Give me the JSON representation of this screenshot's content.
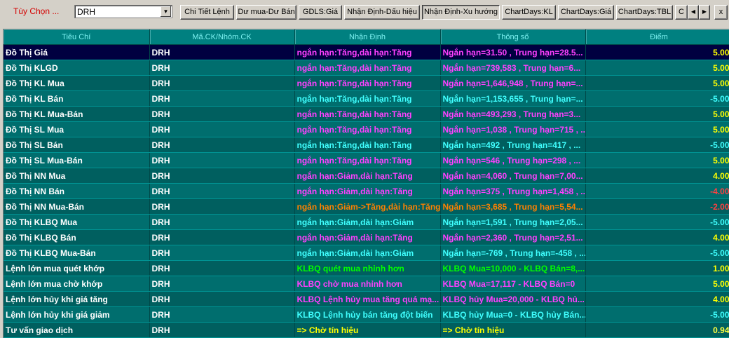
{
  "toolbar": {
    "label": "Tùy Chọn ...",
    "symbol_value": "DRH",
    "buttons": [
      "Chi Tiết Lệnh",
      "Dư mua-Dư Bán",
      "GDLS:Giá",
      "Nhận Định-Dấu hiệu",
      "Nhận Định-Xu hướng",
      "ChartDays:KL",
      "ChartDays:Giá",
      "ChartDays:TBL",
      "C"
    ],
    "pressed_button": "Nhận Định-Xu hướng",
    "prev_label": "◀",
    "next_label": "▶",
    "close_label": "x"
  },
  "table": {
    "headers": [
      "Tiêu Chí",
      "Mã.CK/Nhóm.CK",
      "Nhận Định",
      "Thông số",
      "Điểm"
    ],
    "colors": {
      "magenta": "#ff40ff",
      "cyan": "#40ffff",
      "orange": "#ff8000",
      "green": "#00ff00",
      "yellow": "#ffff00",
      "pos_score": "#ffff00",
      "neg_score": "#40ffff",
      "red_score": "#ff4040",
      "low_score": "#ffff40"
    },
    "rows": [
      {
        "name": "Đồ Thị Giá",
        "code": "DRH",
        "assessment": "ngắn hạn:Tăng,dài hạn:Tăng",
        "params": "Ngắn hạn=31.50 , Trung hạn=28.5...",
        "score": "5.00",
        "color": "magenta",
        "score_color": "pos_score"
      },
      {
        "name": "Đồ Thị KLGD",
        "code": "DRH",
        "assessment": "ngắn hạn:Tăng,dài hạn:Tăng",
        "params": "Ngắn hạn=739,583 , Trung hạn=6...",
        "score": "5.00",
        "color": "magenta",
        "score_color": "pos_score"
      },
      {
        "name": "Đồ Thị KL Mua",
        "code": "DRH",
        "assessment": "ngắn hạn:Tăng,dài hạn:Tăng",
        "params": "Ngắn hạn=1,646,948 , Trung hạn=...",
        "score": "5.00",
        "color": "magenta",
        "score_color": "pos_score"
      },
      {
        "name": "Đồ Thị KL Bán",
        "code": "DRH",
        "assessment": "ngắn hạn:Tăng,dài hạn:Tăng",
        "params": "Ngắn hạn=1,153,655 , Trung hạn=...",
        "score": "-5.00",
        "color": "cyan",
        "score_color": "neg_score"
      },
      {
        "name": "Đồ Thị KL Mua-Bán",
        "code": "DRH",
        "assessment": "ngắn hạn:Tăng,dài hạn:Tăng",
        "params": "Ngắn hạn=493,293 , Trung hạn=3...",
        "score": "5.00",
        "color": "magenta",
        "score_color": "pos_score"
      },
      {
        "name": "Đồ Thị SL Mua",
        "code": "DRH",
        "assessment": "ngắn hạn:Tăng,dài hạn:Tăng",
        "params": "Ngắn hạn=1,038 , Trung hạn=715 , ...",
        "score": "5.00",
        "color": "magenta",
        "score_color": "pos_score"
      },
      {
        "name": "Đồ Thị SL Bán",
        "code": "DRH",
        "assessment": "ngắn hạn:Tăng,dài hạn:Tăng",
        "params": "Ngắn hạn=492 , Trung hạn=417 , ...",
        "score": "-5.00",
        "color": "cyan",
        "score_color": "neg_score"
      },
      {
        "name": "Đồ Thị SL Mua-Bán",
        "code": "DRH",
        "assessment": "ngắn hạn:Tăng,dài hạn:Tăng",
        "params": "Ngắn hạn=546 , Trung hạn=298 , ...",
        "score": "5.00",
        "color": "magenta",
        "score_color": "pos_score"
      },
      {
        "name": "Đồ Thị NN Mua",
        "code": "DRH",
        "assessment": "ngắn hạn:Giảm,dài hạn:Tăng",
        "params": "Ngắn hạn=4,060 , Trung hạn=7,00...",
        "score": "4.00",
        "color": "magenta",
        "score_color": "pos_score"
      },
      {
        "name": "Đồ Thị NN Bán",
        "code": "DRH",
        "assessment": "ngắn hạn:Giảm,dài hạn:Tăng",
        "params": "Ngắn hạn=375 , Trung hạn=1,458 , ...",
        "score": "-4.00",
        "color": "magenta",
        "score_color": "red_score"
      },
      {
        "name": "Đồ Thị NN Mua-Bán",
        "code": "DRH",
        "assessment": "ngắn hạn:Giảm->Tăng,dài hạn:Tăng",
        "params": "Ngắn hạn=3,685 , Trung hạn=5,54...",
        "score": "-2.00",
        "color": "orange",
        "score_color": "red_score"
      },
      {
        "name": "Đồ Thị KLBQ Mua",
        "code": "DRH",
        "assessment": "ngắn hạn:Giảm,dài hạn:Giảm",
        "params": "Ngắn hạn=1,591 , Trung hạn=2,05...",
        "score": "-5.00",
        "color": "cyan",
        "score_color": "neg_score"
      },
      {
        "name": "Đồ Thị KLBQ Bán",
        "code": "DRH",
        "assessment": "ngắn hạn:Giảm,dài hạn:Tăng",
        "params": "Ngắn hạn=2,360 , Trung hạn=2,51...",
        "score": "4.00",
        "color": "magenta",
        "score_color": "pos_score"
      },
      {
        "name": "Đồ Thị KLBQ Mua-Bán",
        "code": "DRH",
        "assessment": "ngắn hạn:Giảm,dài hạn:Giảm",
        "params": "Ngắn hạn=-769 , Trung hạn=-458 , ...",
        "score": "-5.00",
        "color": "cyan",
        "score_color": "neg_score"
      },
      {
        "name": "Lệnh lớn mua quét khớp",
        "code": "DRH",
        "assessment": "KLBQ quét mua nhỉnh hơn",
        "params": "KLBQ Mua=10,000 - KLBQ Bán=8,...",
        "score": "1.00",
        "color": "green",
        "score_color": "pos_score"
      },
      {
        "name": "Lệnh lớn mua chờ khớp",
        "code": "DRH",
        "assessment": "KLBQ chờ mua nhỉnh hơn",
        "params": "KLBQ Mua=17,117 - KLBQ Bán=0",
        "score": "5.00",
        "color": "magenta",
        "score_color": "pos_score"
      },
      {
        "name": "Lệnh lớn hủy khi giá tăng",
        "code": "DRH",
        "assessment": "KLBQ Lệnh hủy mua tăng quá mạ...",
        "params": "KLBQ hủy Mua=20,000 - KLBQ hủ...",
        "score": "4.00",
        "color": "magenta",
        "score_color": "pos_score"
      },
      {
        "name": "Lệnh lớn hủy khi giá giảm",
        "code": "DRH",
        "assessment": "KLBQ Lệnh hủy bán tăng đột biến",
        "params": "KLBQ hủy Mua=0 - KLBQ hủy Bán...",
        "score": "-5.00",
        "color": "cyan",
        "score_color": "neg_score"
      },
      {
        "name": "Tư vấn giao dịch",
        "code": "DRH",
        "assessment": "=> Chờ tín hiệu",
        "params": "=> Chờ tín hiệu",
        "score": "0.94",
        "color": "yellow",
        "score_color": "low_score"
      }
    ],
    "selected_row": 0
  }
}
